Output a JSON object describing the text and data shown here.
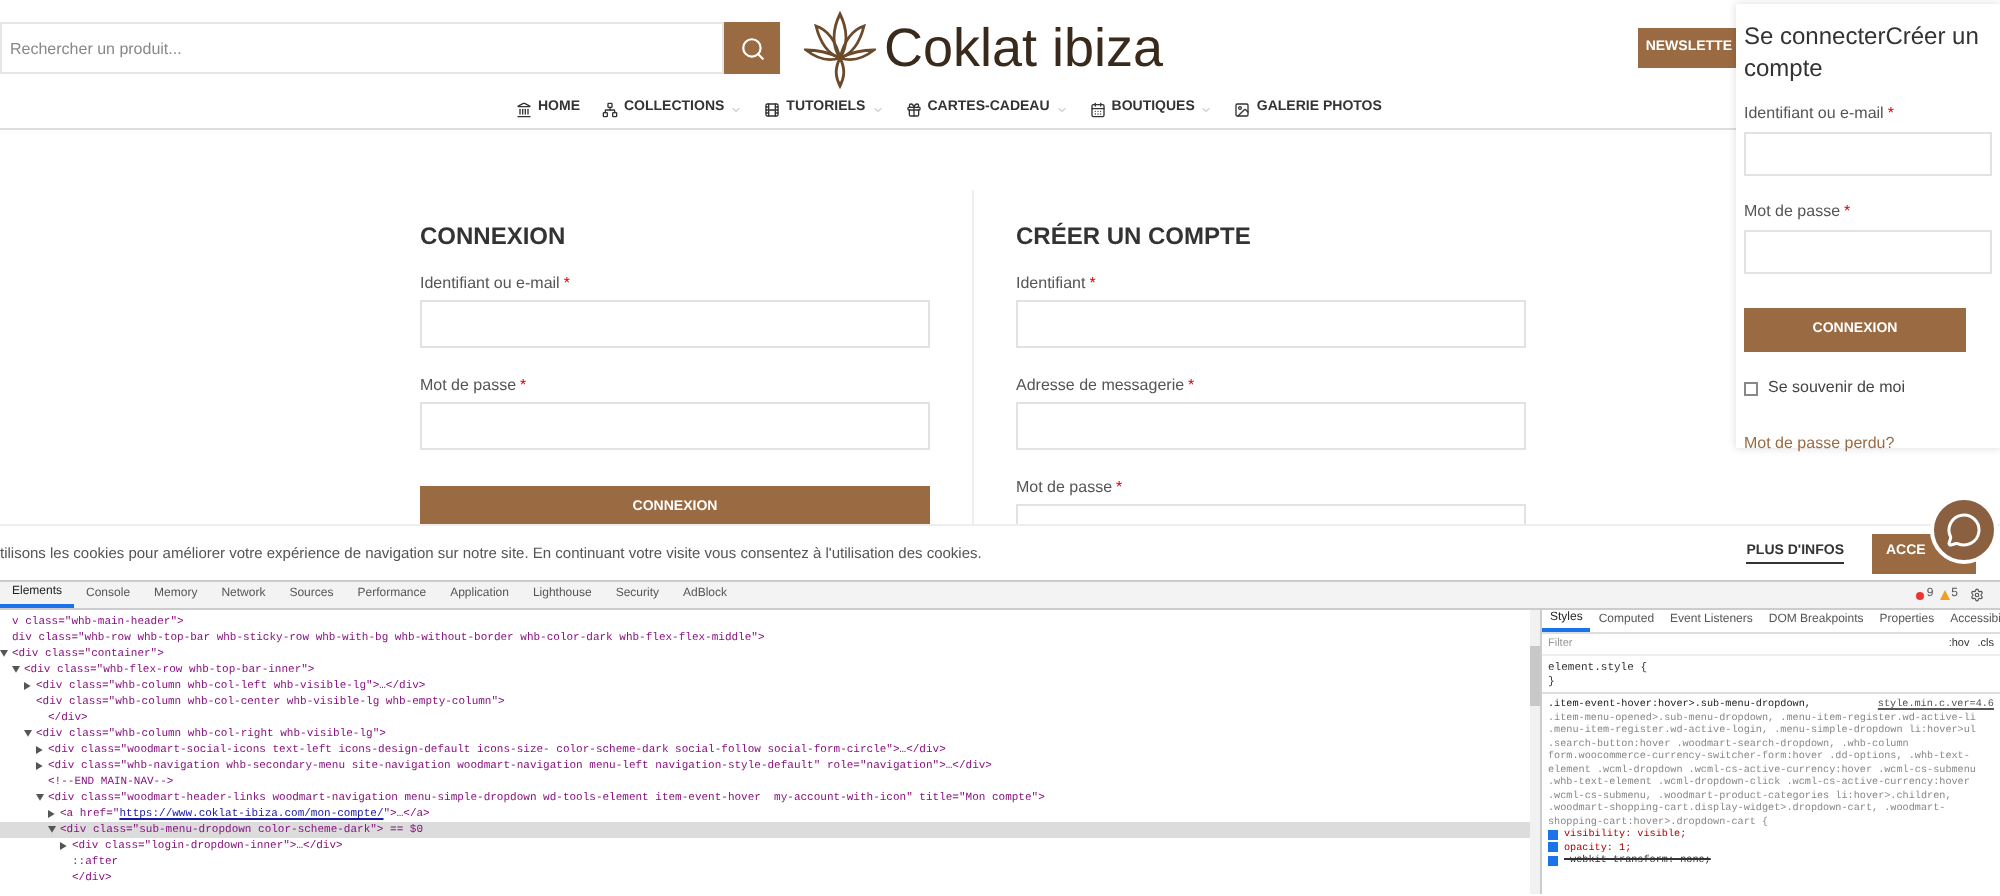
{
  "header": {
    "search": {
      "placeholder": "Rechercher un produit..."
    },
    "logo": {
      "text": "Coklat ibiza"
    },
    "newsletter_button": "NEWSLETTE",
    "nav": [
      {
        "label": "HOME",
        "has_dropdown": false
      },
      {
        "label": "COLLECTIONS",
        "has_dropdown": true
      },
      {
        "label": "TUTORIELS",
        "has_dropdown": true
      },
      {
        "label": "CARTES-CADEAU",
        "has_dropdown": true
      },
      {
        "label": "BOUTIQUES",
        "has_dropdown": true
      },
      {
        "label": "GALERIE PHOTOS",
        "has_dropdown": false
      }
    ]
  },
  "login": {
    "title": "CONNEXION",
    "fields": [
      {
        "label": "Identifiant ou e-mail",
        "required_mark": "*"
      },
      {
        "label": "Mot de passe",
        "required_mark": "*"
      }
    ],
    "button": "CONNEXION"
  },
  "register": {
    "title": "CRÉER UN COMPTE",
    "fields": [
      {
        "label": "Identifiant",
        "required_mark": "*"
      },
      {
        "label": "Adresse de messagerie",
        "required_mark": "*"
      },
      {
        "label": "Mot de passe",
        "required_mark": "*"
      }
    ]
  },
  "dropdown": {
    "heading": "Se connecterCréer un compte",
    "fields": [
      {
        "label": "Identifiant ou e-mail",
        "required_mark": "*"
      },
      {
        "label": "Mot de passe",
        "required_mark": "*"
      }
    ],
    "button": "CONNEXION",
    "remember": {
      "label": "Se souvenir de moi",
      "checked": false
    },
    "lost_password": "Mot de passe perdu?"
  },
  "cookie_bar": {
    "text": "tilisons les cookies pour améliorer votre expérience de navigation sur notre site. En continuant votre visite vous consentez à l'utilisation des cookies.",
    "more_link": "PLUS D'INFOS",
    "accept_button": "ACCE"
  },
  "devtools": {
    "tabs": [
      {
        "label": "Elements",
        "selected": true
      },
      {
        "label": "Console",
        "selected": false
      },
      {
        "label": "Memory",
        "selected": false
      },
      {
        "label": "Network",
        "selected": false
      },
      {
        "label": "Sources",
        "selected": false
      },
      {
        "label": "Performance",
        "selected": false
      },
      {
        "label": "Application",
        "selected": false
      },
      {
        "label": "Lighthouse",
        "selected": false
      },
      {
        "label": "Security",
        "selected": false
      },
      {
        "label": "AdBlock",
        "selected": false
      }
    ],
    "errors": "9",
    "warnings": "5",
    "dom_tree": [
      {
        "kind": "leaf",
        "text": "v class=\"whb-main-header\">",
        "selected": false
      },
      {
        "kind": "leaf",
        "text": "div class=\"whb-row whb-top-bar whb-sticky-row whb-with-bg whb-without-border whb-color-dark whb-flex-flex-middle\">",
        "selected": false
      },
      {
        "kind": "open",
        "text": "<div class=\"container\">",
        "selected": false,
        "children": [
          {
            "kind": "open",
            "text": "<div class=\"whb-flex-row whb-top-bar-inner\">",
            "selected": false,
            "children": [
              {
                "kind": "closed",
                "text": "<div class=\"whb-column whb-col-left whb-visible-lg\">…</div>",
                "selected": false
              },
              {
                "kind": "leaf",
                "text": "<div class=\"whb-column whb-col-center whb-visible-lg whb-empty-column\">",
                "selected": false,
                "children": [
                  {
                    "kind": "leaf",
                    "text": "</div>",
                    "selected": false
                  }
                ]
              },
              {
                "kind": "open",
                "text": "<div class=\"whb-column whb-col-right whb-visible-lg\">",
                "selected": false,
                "children": [
                  {
                    "kind": "closed",
                    "text": "<div class=\"woodmart-social-icons text-left icons-design-default icons-size- color-scheme-dark social-follow social-form-circle\">…</div>",
                    "selected": false
                  },
                  {
                    "kind": "closed",
                    "text": "<div class=\"whb-navigation whb-secondary-menu site-navigation woodmart-navigation menu-left navigation-style-default\" role=\"navigation\">…</div>",
                    "selected": false
                  },
                  {
                    "kind": "leaf",
                    "text": "<!--END MAIN-NAV-->",
                    "selected": false
                  },
                  {
                    "kind": "open",
                    "text": "<div class=\"woodmart-header-links woodmart-navigation menu-simple-dropdown wd-tools-element item-event-hover  my-account-with-icon\" title=\"Mon compte\">",
                    "selected": false,
                    "children": [
                      {
                        "kind": "closed",
                        "text": "<a href=\"",
                        "link": "https://www.coklat-ibiza.com/mon-compte/",
                        "text_after": "\">…</a>",
                        "selected": false
                      },
                      {
                        "kind": "open",
                        "text": "<div class=\"sub-menu-dropdown color-scheme-dark\"> == $0",
                        "selected": true,
                        "children": [
                          {
                            "kind": "closed",
                            "text": "<div class=\"login-dropdown-inner\">…</div>",
                            "selected": false
                          },
                          {
                            "kind": "leaf",
                            "text": "::after",
                            "selected": false
                          },
                          {
                            "kind": "leaf",
                            "text": "</div>",
                            "selected": false
                          }
                        ]
                      }
                    ]
                  }
                ]
              }
            ]
          }
        ]
      }
    ],
    "styles": {
      "tabs": [
        {
          "label": "Styles",
          "selected": true
        },
        {
          "label": "Computed",
          "selected": false
        },
        {
          "label": "Event Listeners",
          "selected": false
        },
        {
          "label": "DOM Breakpoints",
          "selected": false
        },
        {
          "label": "Properties",
          "selected": false
        },
        {
          "label": "Accessibi",
          "selected": false
        }
      ],
      "filter_placeholder": "Filter",
      "hov": ":hov",
      "cls": ".cls",
      "element_style": [
        "element.style {",
        "}"
      ],
      "rule": {
        "source": "style.min.c.ver=4.6",
        "selector_lines": [
          ".item-event-hover:hover>.sub-menu-dropdown,",
          ".item-menu-opened>.sub-menu-dropdown, .menu-item-register.wd-active-li",
          ".menu-item-register.wd-active-login, .menu-simple-dropdown li:hover>ul",
          ".search-button:hover .woodmart-search-dropdown, .whb-column",
          "form.woocommerce-currency-switcher-form:hover .dd-options, .whb-text-",
          "element .wcml-dropdown .wcml-cs-active-currency:hover .wcml-cs-submenu",
          ".whb-text-element .wcml-dropdown-click .wcml-cs-active-currency:hover",
          ".wcml-cs-submenu, .woodmart-product-categories li:hover>.children,",
          ".woodmart-shopping-cart.display-widget>.dropdown-cart, .woodmart-",
          "shopping-cart:hover>.dropdown-cart {"
        ],
        "declarations": [
          {
            "text": "visibility: visible;",
            "checked": true,
            "overridden": false
          },
          {
            "text": "opacity: 1;",
            "checked": true,
            "overridden": false
          },
          {
            "text": "-webkit-transform: none;",
            "checked": true,
            "overridden": true
          }
        ]
      }
    }
  }
}
